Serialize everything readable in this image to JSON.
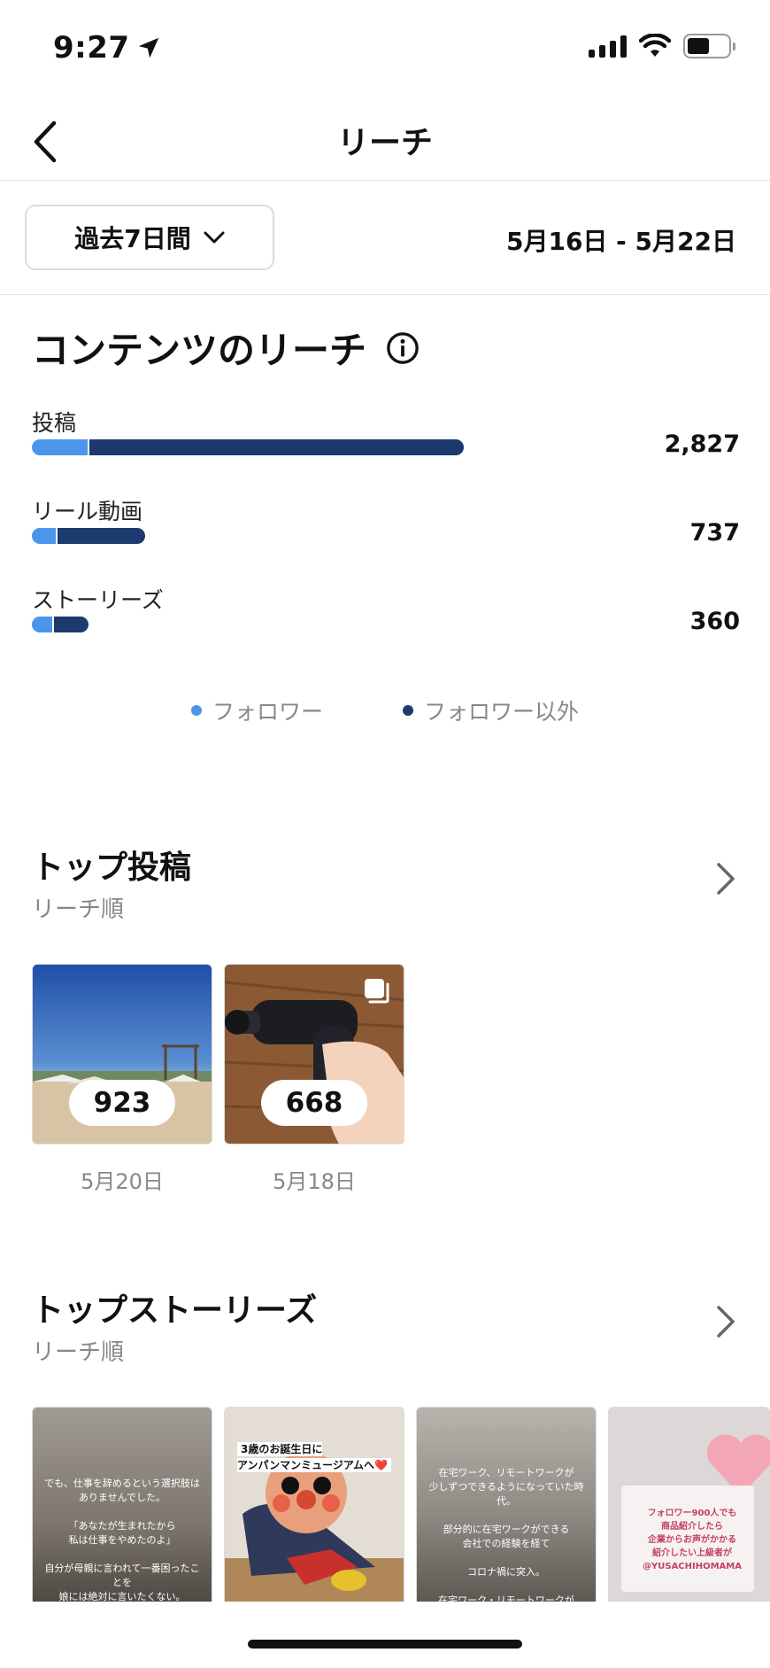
{
  "status_bar": {
    "time": "9:27"
  },
  "nav": {
    "title": "リーチ"
  },
  "range": {
    "selected": "過去7日間",
    "dates": "5月16日 - 5月22日"
  },
  "content_reach": {
    "title": "コンテンツのリーチ",
    "rows": [
      {
        "label": "投稿",
        "value": "2,827",
        "follower_fraction": 0.13,
        "total_fraction": 0.61
      },
      {
        "label": "リール動画",
        "value": "737",
        "follower_fraction": 0.21,
        "total_fraction": 0.16
      },
      {
        "label": "ストーリーズ",
        "value": "360",
        "follower_fraction": 0.36,
        "total_fraction": 0.08
      }
    ],
    "legend": [
      {
        "label": "フォロワー",
        "color": "#4b96ea"
      },
      {
        "label": "フォロワー以外",
        "color": "#1c3a6e"
      }
    ]
  },
  "top_posts": {
    "title": "トップ投稿",
    "subtitle": "リーチ順",
    "items": [
      {
        "count": "923",
        "date": "5月20日"
      },
      {
        "count": "668",
        "date": "5月18日"
      }
    ]
  },
  "top_stories": {
    "title": "トップストーリーズ",
    "subtitle": "リーチ順",
    "items": [
      {
        "text": "でも、仕事を辞めるという選択肢は\nありませんでした。\n\n「あなたが生まれたから\n私は仕事をやめたのよ」\n\n自分が母親に言われて一番困ったことを\n娘には絶対に言いたくない。\n\n今辞めたら\nうっかり言ってしまうかもしれない"
      },
      {
        "text": "3歳のお誕生日に\nアンパンマンミュージアムへ❤️"
      },
      {
        "text": "在宅ワーク、リモートワークが\n少しずつできるようになっていた時代。\n\n部分的に在宅ワークができる\n会社での経験を経て\n\nコロナ禍に突入。\n\n在宅ワーク・リモートワークが\nより浸透した時代の追い風を受けて"
      },
      {
        "text": "フォロワー900人でも\n商品紹介したら\n企業からお声がかかる\n紹介したい上級者が\n@YUSACHIHOMAMA"
      }
    ]
  }
}
